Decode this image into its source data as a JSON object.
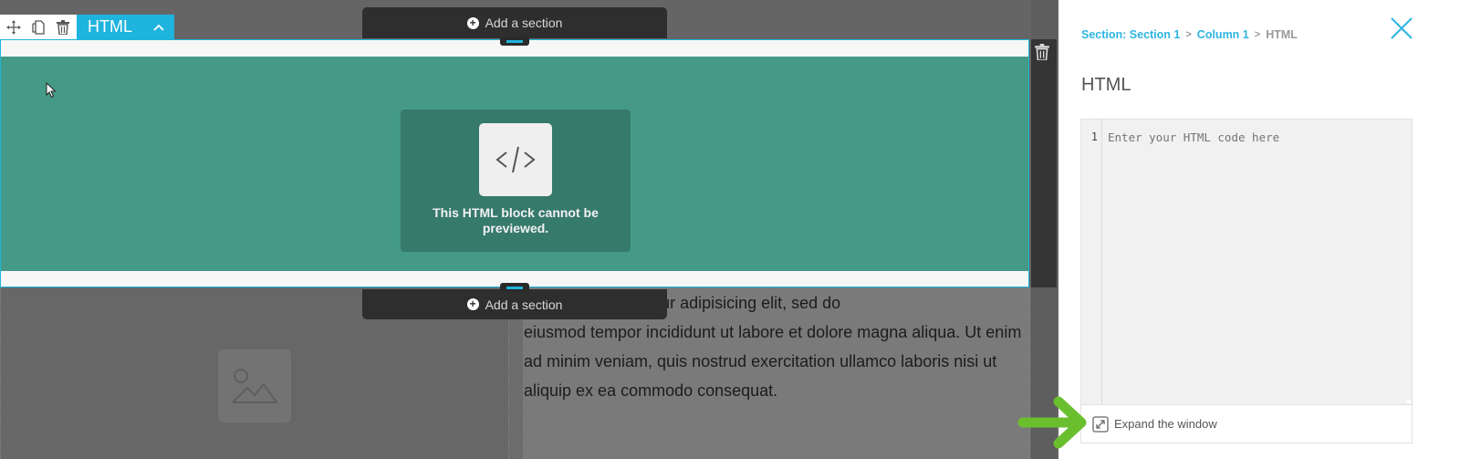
{
  "toolbar": {
    "icons": [
      "move-icon",
      "duplicate-icon",
      "delete-icon"
    ],
    "element_type": "HTML"
  },
  "canvas": {
    "add_section_top": "Add a section",
    "add_section_bottom": "Add a section",
    "html_block": {
      "preview_message": "This HTML block cannot be previewed.",
      "code_glyph": "</>"
    },
    "lorem_text_visible": "sit amet, consectetur adipisicing elit, sed do eiusmod tempor incididunt ut labore et dolore magna aliqua. Ut enim ad minim veniam, quis nostrud exercitation ullamco laboris nisi ut aliquip ex ea commodo consequat.",
    "lorem_lines": [
      "sit amet, consectetur adipisicing elit, sed do",
      "eiusmod tempor incididunt ut labore et dolore magna aliqua. Ut enim",
      "ad minim veniam, quis nostrud exercitation ullamco laboris nisi ut",
      "aliquip ex ea commodo consequat."
    ]
  },
  "panel": {
    "breadcrumb": [
      {
        "label": "Section: Section 1",
        "link": true
      },
      {
        "label": "Column 1",
        "link": true
      },
      {
        "label": "HTML",
        "link": false
      }
    ],
    "breadcrumb_separator": ">",
    "title": "HTML",
    "editor": {
      "line_number": "1",
      "value": "",
      "placeholder": "Enter your HTML code here"
    },
    "expand_label": "Expand the window"
  },
  "colors": {
    "accent": "#1fb4dd",
    "section_bg": "#449a87",
    "card_bg": "#367a6c",
    "arrow": "#6abf2e"
  }
}
